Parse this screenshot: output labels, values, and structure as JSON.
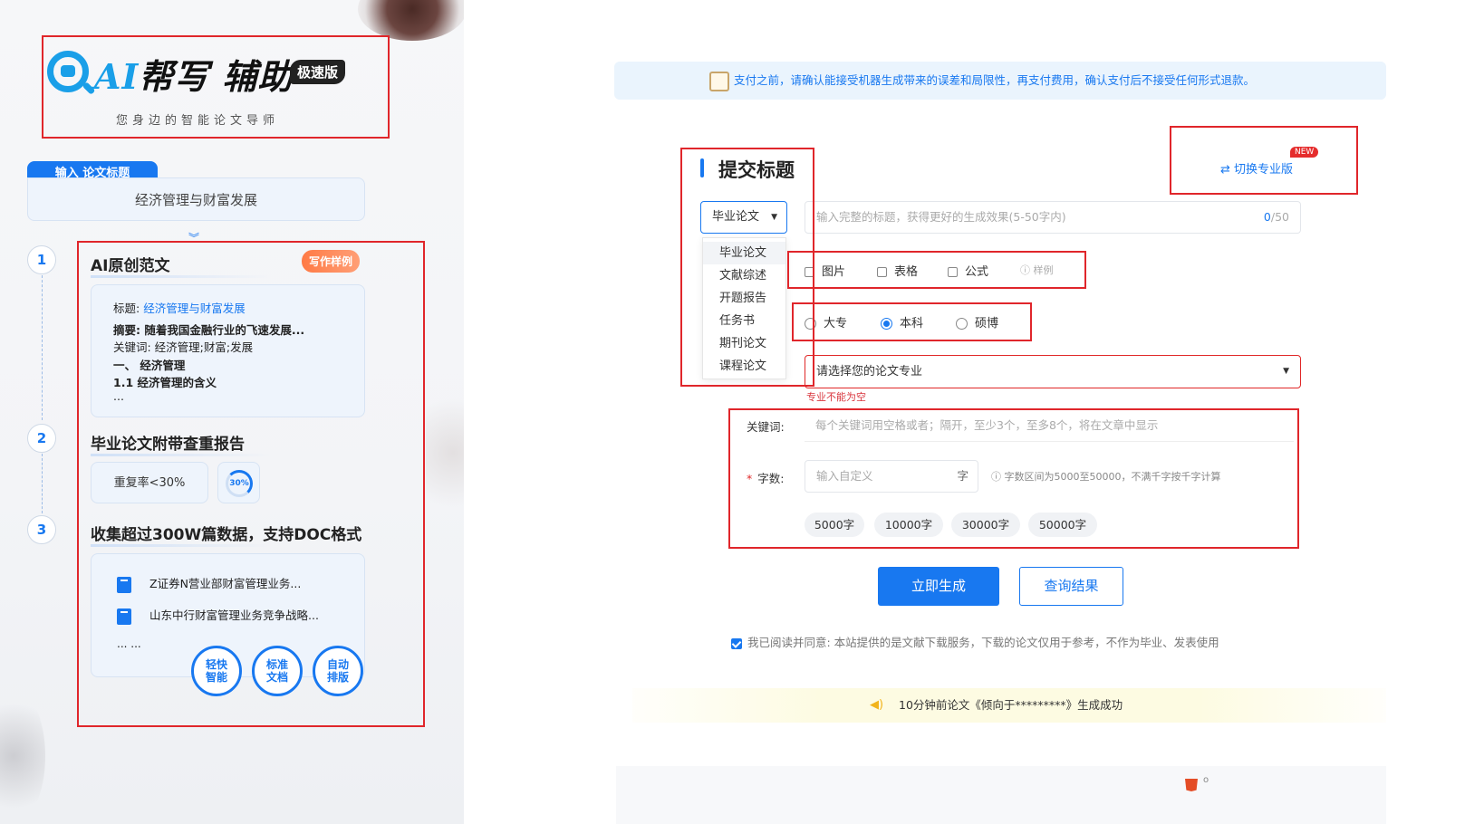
{
  "left": {
    "logo": {
      "ai": "AI",
      "title": "帮写 辅助",
      "badge": "极速版",
      "subtitle": "您身边的智能论文导师"
    },
    "input": {
      "tab_label": "输入 论文标题",
      "value": "经济管理与财富发展"
    },
    "steps": [
      "1",
      "2",
      "3"
    ],
    "section1": {
      "title": "AI原创范文",
      "badge": "写作样例",
      "title_label": "标题:",
      "title_value": "经济管理与财富发展",
      "abstract": "摘要: 随着我国金融行业的飞速发展...",
      "keywords": "关键词: 经济管理;财富;发展",
      "heading1": "一、 经济管理",
      "heading2": "1.1 经济管理的含义",
      "ellipsis": "..."
    },
    "section2": {
      "title": "毕业论文附带查重报告",
      "pill": "重复率<30%",
      "ring_label": "30%",
      "ring_value_percent": 30
    },
    "section3": {
      "title": "收集超过300W篇数据，支持DOC格式",
      "docs": [
        "Z证券N营业部财富管理业务...",
        "山东中行财富管理业务竞争战略..."
      ],
      "more": "... ...",
      "circles": [
        {
          "line1": "轻快",
          "line2": "智能"
        },
        {
          "line1": "标准",
          "line2": "文档"
        },
        {
          "line1": "自动",
          "line2": "排版"
        }
      ]
    }
  },
  "right": {
    "notice": "支付之前，请确认能接受机器生成带来的误差和局限性，再支付费用，确认支付后不接受任何形式退款。",
    "form_title": "提交标题",
    "switch_label": "⇄ 切换专业版",
    "new_badge": "NEW",
    "paper_type": {
      "selected": "毕业论文",
      "options": [
        "毕业论文",
        "文献综述",
        "开题报告",
        "任务书",
        "期刊论文",
        "课程论文"
      ]
    },
    "title_input": {
      "placeholder": "输入完整的标题，获得更好的生成效果(5-50字内)",
      "count": "0",
      "max": "/50"
    },
    "attachments": [
      "图片",
      "表格",
      "公式"
    ],
    "sample_link": "ⓘ 样例",
    "degree": {
      "options": [
        "大专",
        "本科",
        "硕博"
      ],
      "selected": "本科"
    },
    "major": {
      "placeholder": "请选择您的论文专业",
      "error": "专业不能为空"
    },
    "keywords": {
      "label": "关键词:",
      "placeholder": "每个关键词用空格或者；隔开，至少3个，至多8个，将在文章中显示"
    },
    "word_count": {
      "required_mark": "*",
      "label": "字数:",
      "placeholder": "输入自定义",
      "unit": "字",
      "hint": "ⓘ 字数区间为5000至50000，不满千字按千字计算",
      "presets": [
        "5000字",
        "10000字",
        "30000字",
        "50000字"
      ]
    },
    "buttons": {
      "generate": "立即生成",
      "query": "查询结果"
    },
    "agreement": "我已阅读并同意: 本站提供的是文献下载服务，下载的论文仅用于参考，不作为毕业、发表使用",
    "ticker": "10分钟前论文《倾向于*********》生成成功",
    "footer_text": "o"
  },
  "colors": {
    "accent": "#1878f0",
    "error": "#e02828",
    "annotation": "#e0262b"
  },
  "icons": [
    "search-robot-logo-icon",
    "chevron-down-icon",
    "document-icon",
    "caret-down-icon",
    "info-icon",
    "speaker-icon",
    "switch-arrows-icon",
    "notice-scroll-icon",
    "html5-icon"
  ]
}
